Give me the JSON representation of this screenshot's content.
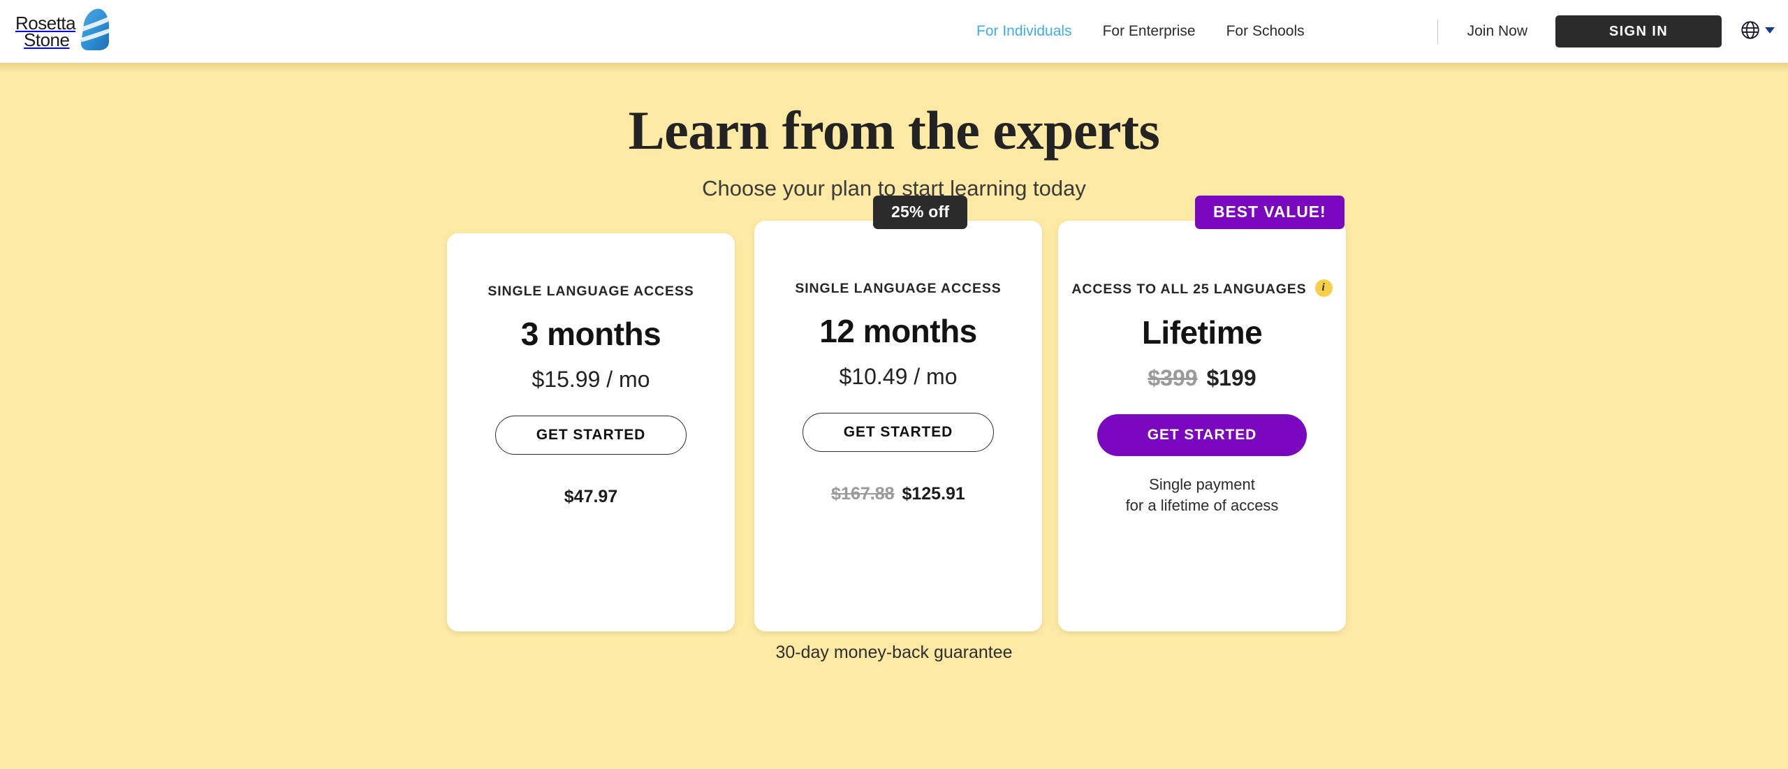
{
  "header": {
    "logo": {
      "line1": "Rosetta",
      "line2": "Stone",
      "icon": "rosetta-stone-logo"
    },
    "nav": [
      {
        "label": "For Individuals",
        "active": true
      },
      {
        "label": "For Enterprise",
        "active": false
      },
      {
        "label": "For Schools",
        "active": false
      }
    ],
    "join_now_label": "Join Now",
    "sign_in_label": "SIGN IN",
    "language_picker": {
      "icon": "globe-icon",
      "chevron": "chevron-down-icon"
    },
    "colors": {
      "active_nav": "#3FAEE8",
      "sign_in_bg": "#2B2B2B"
    }
  },
  "hero": {
    "title": "Learn from the experts",
    "subtitle": "Choose your plan to start learning today"
  },
  "pricing": {
    "plans": [
      {
        "kicker": "SINGLE LANGUAGE ACCESS",
        "term": "3 months",
        "rate": "$15.99 / mo",
        "cta": "GET STARTED",
        "total_old": "",
        "total": "$47.97",
        "note": "",
        "badge": "",
        "has_info_icon": false
      },
      {
        "kicker": "SINGLE LANGUAGE ACCESS",
        "term": "12 months",
        "rate": "$10.49 / mo",
        "cta": "GET STARTED",
        "total_old": "$167.88",
        "total": "$125.91",
        "note": "",
        "badge": "25% off",
        "has_info_icon": false
      },
      {
        "kicker": "ACCESS TO ALL 25 LANGUAGES",
        "term": "Lifetime",
        "rate_old": "$399",
        "rate": "$199",
        "cta": "GET STARTED",
        "total_old": "",
        "total": "",
        "note": "Single payment\nfor a lifetime of access",
        "note_line1": "Single payment",
        "note_line2": "for a lifetime of access",
        "badge": "BEST VALUE!",
        "has_info_icon": true,
        "info_icon_label": "i"
      }
    ],
    "guarantee": "30-day money-back guarantee",
    "colors": {
      "accent_purple": "#7A08BE",
      "badge_dark": "#2B2B2B",
      "page_bg": "#FCEAA4",
      "info_badge": "#F7CF49"
    }
  }
}
